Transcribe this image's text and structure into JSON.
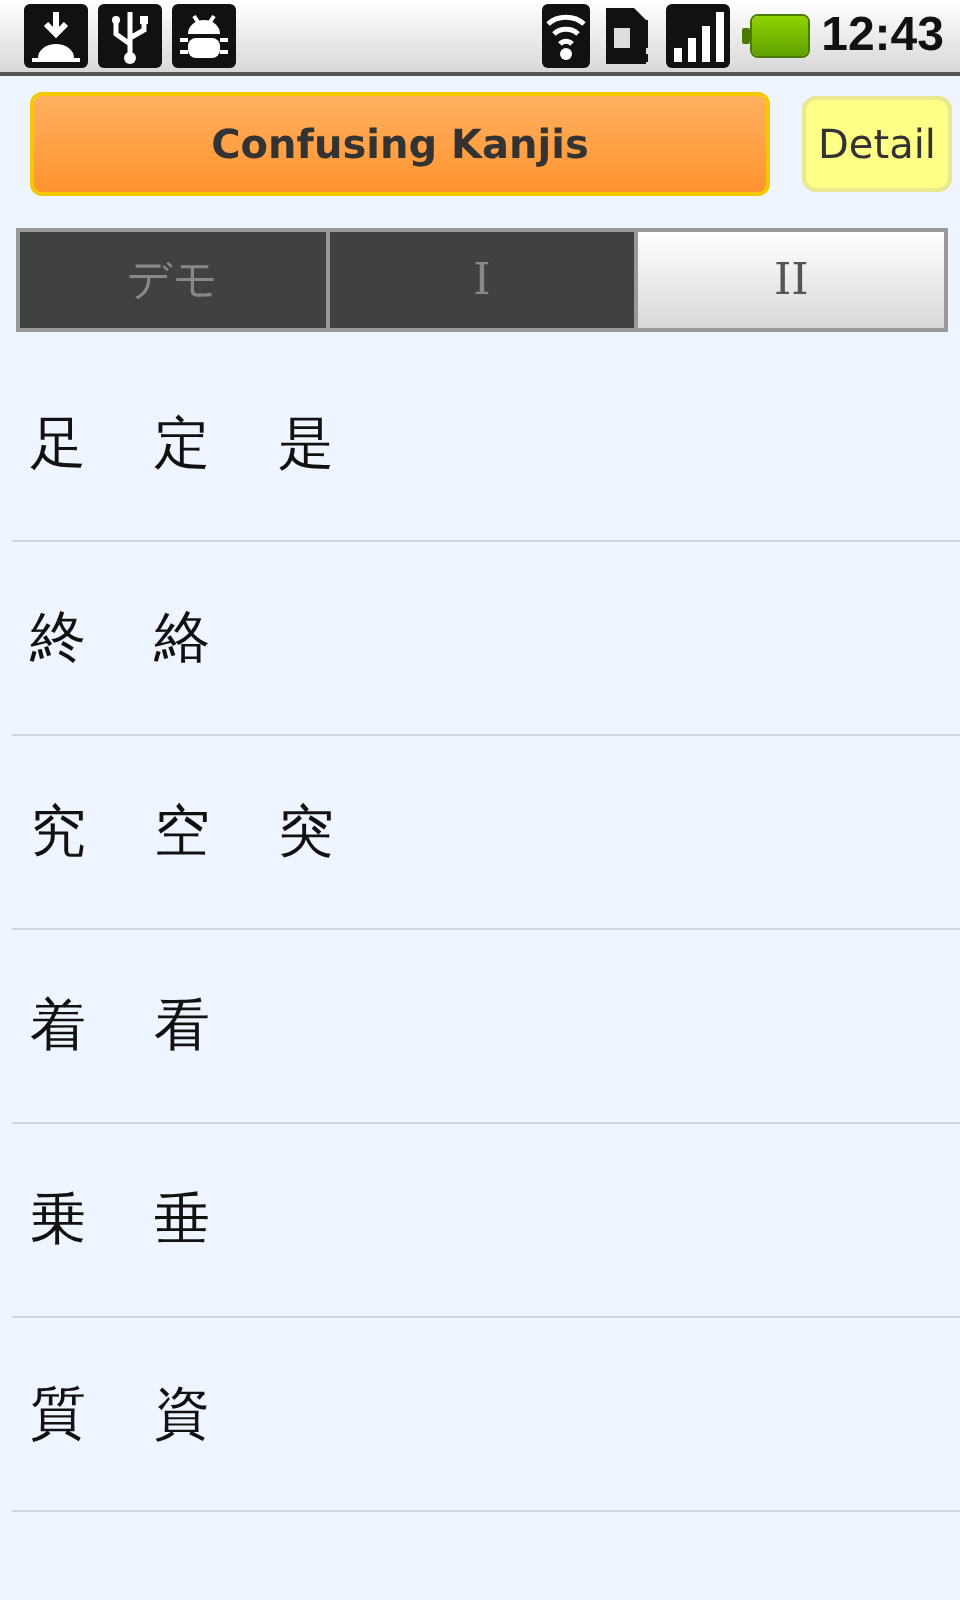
{
  "status_bar": {
    "time": "12:43",
    "battery": {
      "level": 1
    }
  },
  "header": {
    "title": "Confusing Kanjis",
    "detail_button": "Detail"
  },
  "tabs": [
    {
      "label": "デモ",
      "selected": false
    },
    {
      "label": "I",
      "selected": false
    },
    {
      "label": "II",
      "selected": true
    }
  ],
  "rows": [
    {
      "kanjis": [
        "足",
        "定",
        "是"
      ]
    },
    {
      "kanjis": [
        "終",
        "絡"
      ]
    },
    {
      "kanjis": [
        "究",
        "空",
        "突"
      ]
    },
    {
      "kanjis": [
        "着",
        "看"
      ]
    },
    {
      "kanjis": [
        "乗",
        "垂"
      ]
    },
    {
      "kanjis": [
        "質",
        "資"
      ]
    }
  ]
}
